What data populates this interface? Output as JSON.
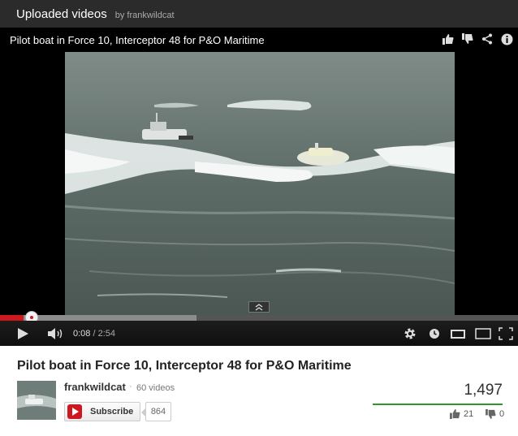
{
  "playlist": {
    "title": "Uploaded videos",
    "owner": "by frankwildcat"
  },
  "player": {
    "title": "Pilot boat in Force 10, Interceptor 48 for P&O Maritime",
    "top_icons": [
      "like-icon",
      "dislike-icon",
      "share-icon",
      "info-icon"
    ],
    "current_time": "0:08",
    "separator": " / ",
    "total_time": "2:54",
    "progress_played": 0.046,
    "progress_buffered": 0.38
  },
  "video_info": {
    "title": "Pilot boat in Force 10, Interceptor 48 for P&O Maritime",
    "channel_name": "frankwildcat",
    "channel_dot": "·",
    "video_count": "60 videos",
    "subscribe_label": "Subscribe",
    "subscriber_count": "864",
    "view_count": "1,497",
    "likes": "21",
    "dislikes": "0",
    "like_ratio": 1.0
  },
  "colors": {
    "accent": "#cc181e",
    "like_bar": "#2b9a2b",
    "player_bg": "#000000"
  }
}
